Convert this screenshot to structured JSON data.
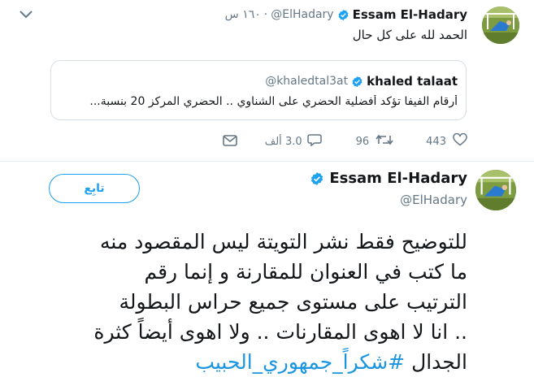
{
  "reply_tweet": {
    "author_name": "Essam El-Hadary",
    "author_handle": "@ElHadary",
    "time": "١٦٠ س",
    "text": "الحمد لله على كل حال",
    "quoted": {
      "author_name": "khaled talaat",
      "author_handle": "@khaledtal3at",
      "text": "أرقام الفيفا تؤكد أفضلية الحضري على الشناوي .. الحضري المركز 20 بنسبة..."
    },
    "actions": {
      "likes": "443",
      "retweets": "96",
      "replies": "3.0 ألف"
    }
  },
  "main_tweet": {
    "author_name": "Essam El-Hadary",
    "author_handle": "@ElHadary",
    "follow_label": "تابِع",
    "text_lines": [
      "للتوضيح فقط نشر التويتة ليس المقصود منه",
      "ما كتب في العنوان للمقارنة و إنما رقم",
      "الترتيب على مستوى جميع حراس البطولة",
      ".. انا لا اهوى المقارنات .. ولا اهوى أيضاً كثرة"
    ],
    "last_line_text": "الجدال",
    "hashtag": "#شكراً_جمهوري_الحبيب"
  },
  "colors": {
    "accent": "#1da1f2",
    "hashtag": "#1b95e0",
    "secondary_text": "#657786",
    "border": "#d6dee4"
  },
  "icons": {
    "verified": "verified-badge-icon",
    "dropdown": "chevron-down-icon",
    "like": "heart-icon",
    "retweet": "retweet-icon",
    "reply": "reply-icon",
    "mail": "envelope-icon"
  }
}
